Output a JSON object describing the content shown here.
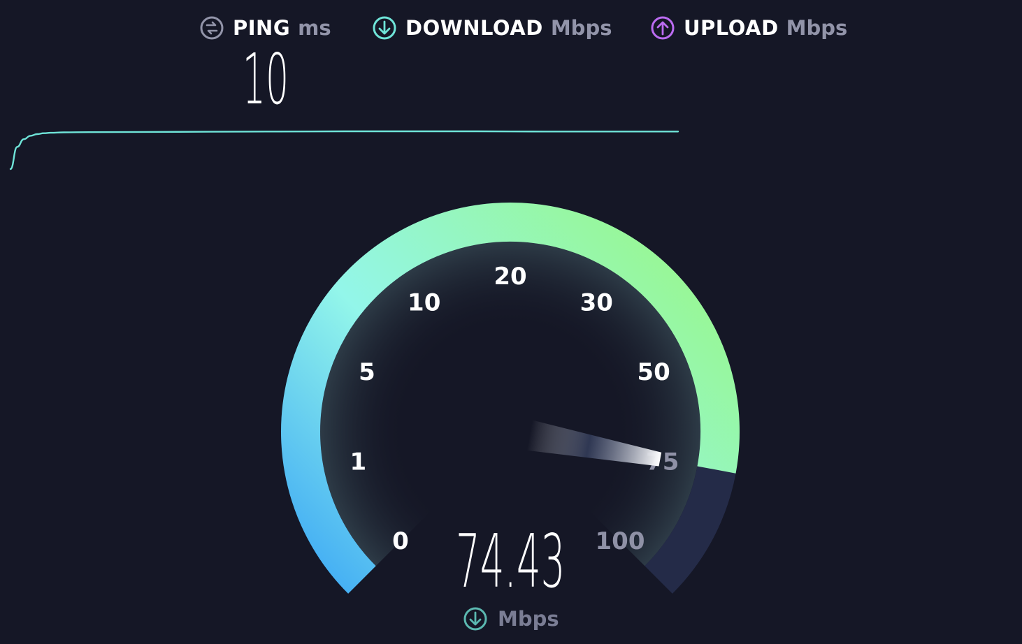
{
  "metrics": {
    "ping": {
      "label": "PING",
      "unit": "ms",
      "icon": "ping-icon",
      "color": "#9294a9"
    },
    "download": {
      "label": "DOWNLOAD",
      "unit": "Mbps",
      "icon": "download-arrow-icon",
      "color": "#6fe4d8"
    },
    "upload": {
      "label": "UPLOAD",
      "unit": "Mbps",
      "icon": "upload-arrow-icon",
      "color": "#bb6bf1"
    }
  },
  "ping_value": "10",
  "gauge": {
    "ticks": [
      "0",
      "1",
      "5",
      "10",
      "20",
      "30",
      "50",
      "75",
      "100"
    ],
    "current_value": "74.43",
    "unit": "Mbps",
    "unit_icon": "download-arrow-icon",
    "gradient_start": "#3da8f5",
    "gradient_mid": "#93f6ea",
    "gradient_end": "#98f792",
    "track_color": "#242b48"
  },
  "chart_data": {
    "type": "line",
    "x": [
      0,
      1,
      2,
      3,
      4,
      5,
      6,
      8,
      12,
      20,
      30,
      40,
      50,
      60,
      70,
      80,
      90,
      100
    ],
    "values": [
      0,
      52,
      70,
      78,
      82,
      84,
      85,
      86,
      86.5,
      87,
      87.5,
      88,
      88.5,
      88.5,
      88.5,
      88,
      88,
      88
    ],
    "color": "#6fe4d8"
  }
}
